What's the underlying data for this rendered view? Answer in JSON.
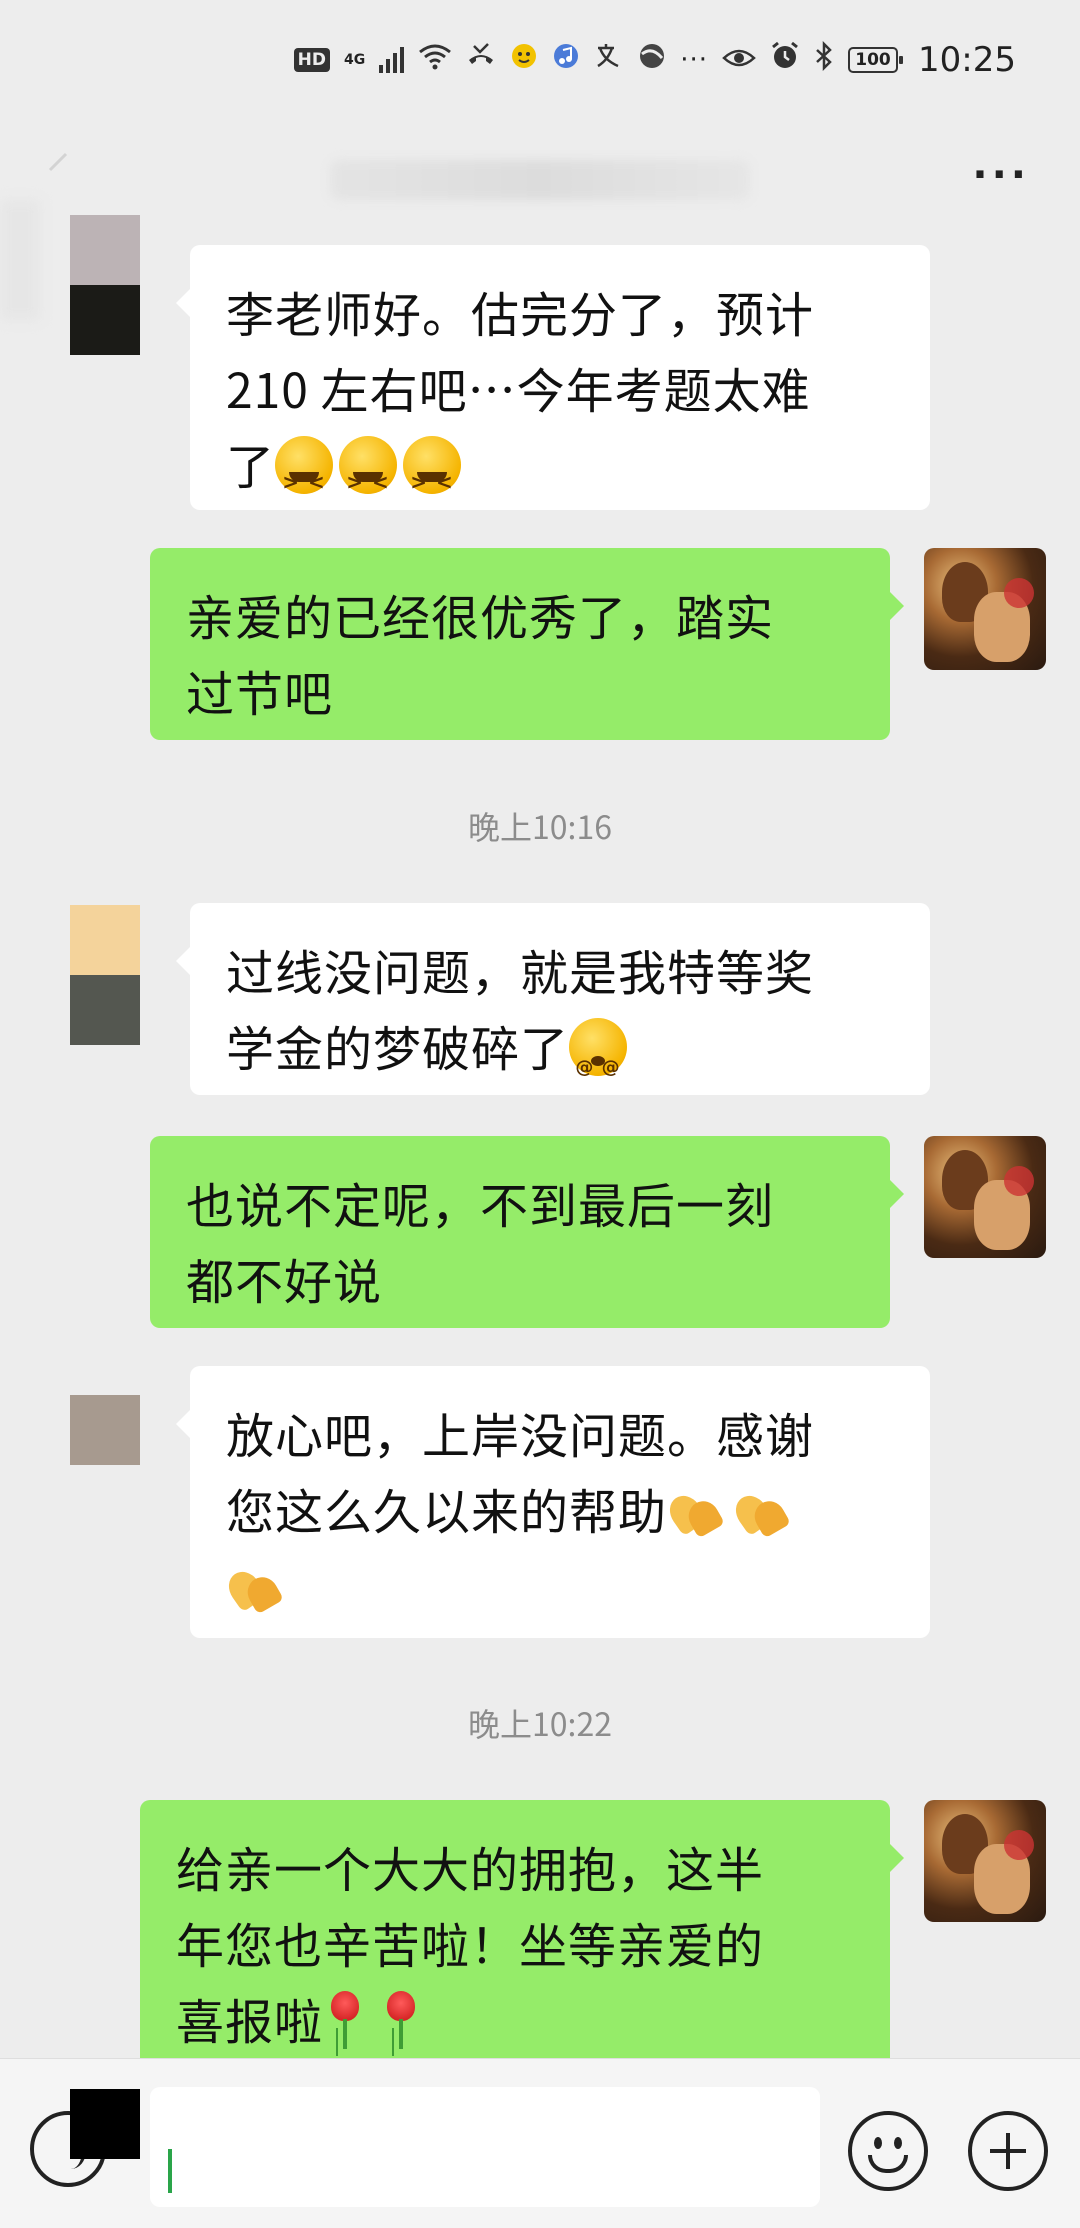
{
  "status_bar": {
    "hd": "HD",
    "signal": "4G",
    "battery": "100",
    "time": "10:25"
  },
  "title_bar": {
    "title": "",
    "back_icon": "chevron-left-icon",
    "more_label": "···"
  },
  "messages": [
    {
      "side": "in",
      "text_lines": [
        "李老师好。估完分了，预计",
        "210 左右吧…今年考题太难",
        "了"
      ]
    },
    {
      "side": "out",
      "text_lines": [
        "亲爱的已经很优秀了，踏实",
        "过节吧"
      ]
    },
    {
      "side": "in",
      "text_lines": [
        "过线没问题，就是我特等奖",
        "学金的梦破碎了"
      ]
    },
    {
      "side": "out",
      "text_lines": [
        "也说不定呢，不到最后一刻",
        "都不好说"
      ]
    },
    {
      "side": "in",
      "text_lines": [
        "放心吧，上岸没问题。感谢",
        "您这么久以来的帮助"
      ]
    },
    {
      "side": "out",
      "text_lines": [
        "给亲一个大大的拥抱，这半",
        "年您也辛苦啦！坐等亲爱的",
        "喜报啦"
      ]
    }
  ],
  "timestamps": [
    "晚上10:16",
    "晚上10:22"
  ],
  "input_bar": {
    "placeholder": "",
    "voice_icon": "voice-icon",
    "emoji_icon": "emoji-icon",
    "plus_icon": "plus-icon"
  },
  "colors": {
    "background": "#ededed",
    "bubble_in": "#ffffff",
    "bubble_out": "#95ec69",
    "timestamp": "#8c8c8c"
  }
}
